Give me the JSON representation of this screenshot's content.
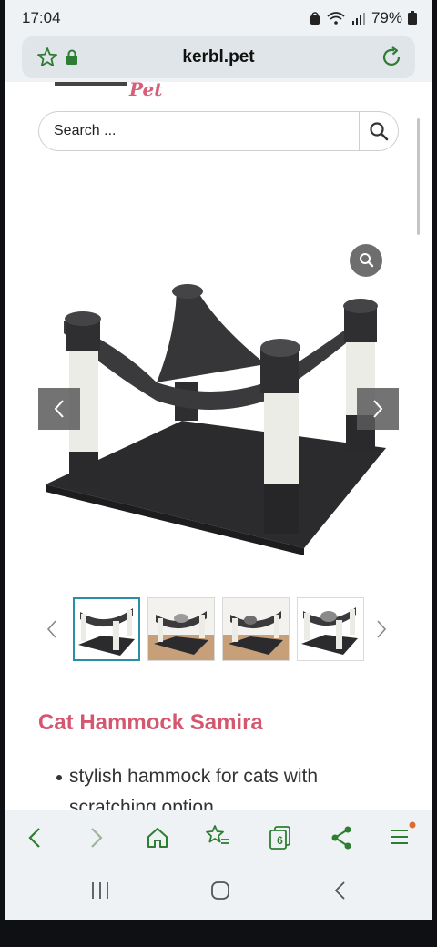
{
  "status_bar": {
    "time": "17:04",
    "battery": "79%"
  },
  "browser": {
    "url": "kerbl.pet",
    "tab_count": "6"
  },
  "site": {
    "logo_text": "Pet"
  },
  "search": {
    "placeholder": "Search ..."
  },
  "product": {
    "title": "Cat Hammock Samira",
    "bullets": [
      "stylish hammock for cats with scratching option"
    ]
  },
  "thumbnails": {
    "count": 4,
    "active_index": 0
  },
  "colors": {
    "accent": "#d4566f",
    "thumb_active": "#2a8fa5",
    "browser_icons": "#2e7d32"
  }
}
